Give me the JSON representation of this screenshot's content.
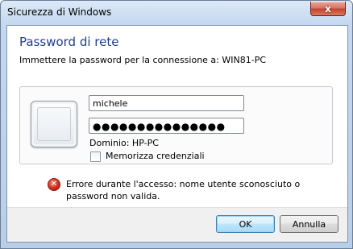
{
  "window": {
    "title": "Sicurezza di Windows",
    "close_glyph": "x"
  },
  "header": {
    "title": "Password di rete",
    "subtitle": "Immettere la password per la connessione a: WIN81-PC"
  },
  "credentials": {
    "username_value": "michele",
    "password_value": "●●●●●●●●●●●●●●●",
    "domain_label": "Dominio: HP-PC",
    "remember_label": "Memorizza credenziali",
    "remember_checked": false
  },
  "error": {
    "icon": "error-icon",
    "message": "Errore durante l'accesso: nome utente sconosciuto o password non valida."
  },
  "buttons": {
    "ok_label": "OK",
    "cancel_label": "Annulla"
  },
  "colors": {
    "header_title": "#1e3f8a",
    "error_red": "#d12d1b",
    "titlebar": "#c4d7ee"
  }
}
